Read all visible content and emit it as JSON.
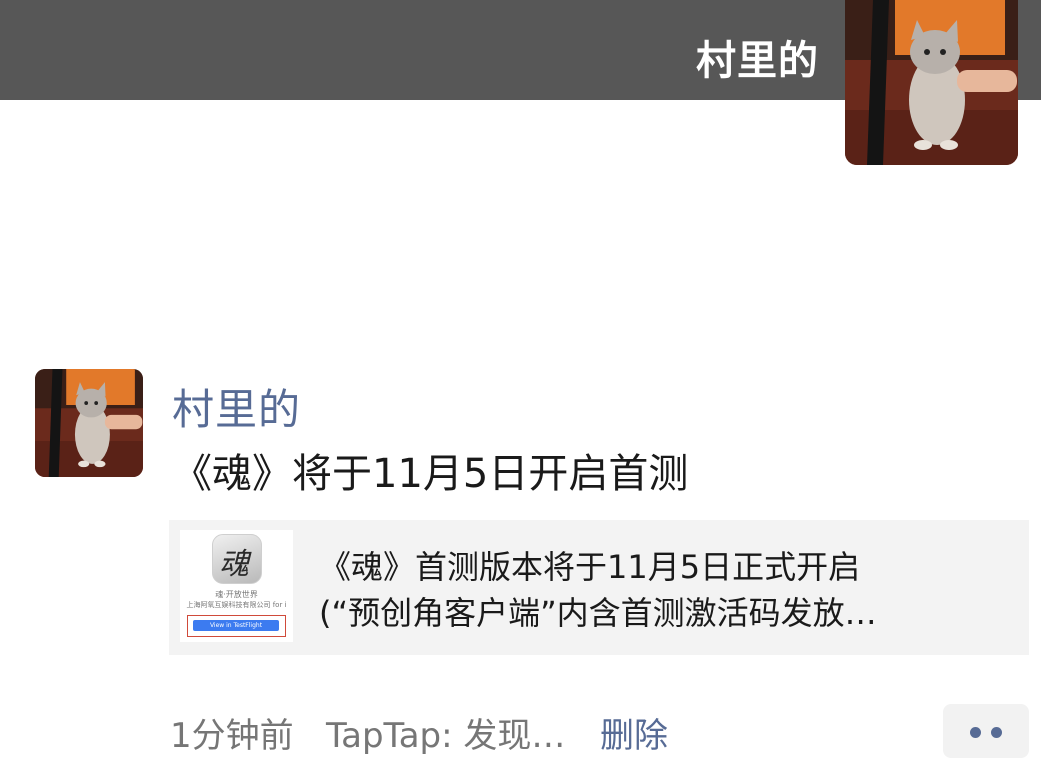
{
  "header": {
    "name": "村里的",
    "avatar_icon": "cat-photo-avatar"
  },
  "post": {
    "author": "村里的",
    "avatar_icon": "cat-photo-avatar",
    "text": "《魂》将于11月5日开启首测",
    "link_card": {
      "thumb": {
        "icon_glyph": "魂",
        "app_name": "魂·开放世界",
        "company": "上海阿氧互娱科技有限公司 for i",
        "button_label": "View in TestFlight"
      },
      "title_line1": "《魂》首测版本将于11月5日正式开启",
      "title_line2": "(“预创角客户端”内含首测激活码发放…"
    },
    "time": "1分钟前",
    "source": "TapTap: 发现…",
    "delete_label": "删除",
    "more_icon": "two-dots-icon"
  },
  "colors": {
    "cover_bg": "#575757",
    "link_blue": "#576b95",
    "card_bg": "#f3f3f3"
  }
}
